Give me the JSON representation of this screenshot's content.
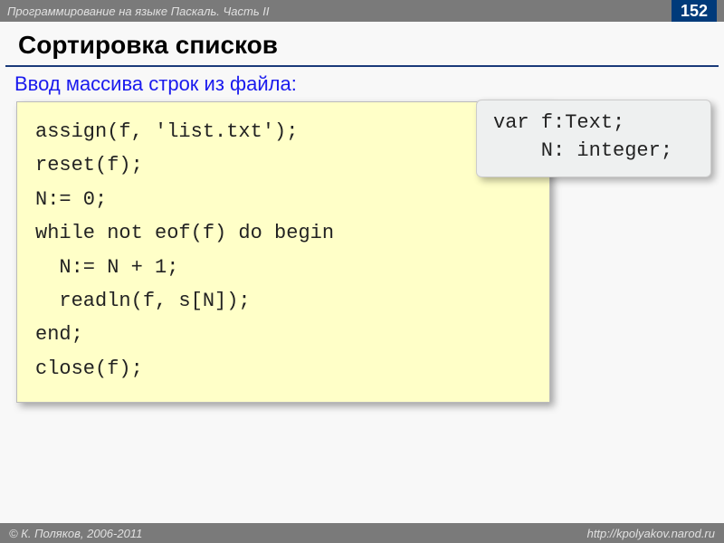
{
  "header": {
    "course_title": "Программирование на языке Паскаль. Часть II",
    "page_number": "152"
  },
  "title": "Сортировка списков",
  "subtitle": "Ввод массива строк из файла:",
  "code": {
    "lines": [
      "assign(f, 'list.txt');",
      "reset(f);",
      "N:= 0;",
      "while not eof(f) do begin",
      "  N:= N + 1;",
      "  readln(f, s[N]);",
      "end;",
      "close(f);"
    ]
  },
  "var_declaration": {
    "lines": [
      "var f:Text;",
      "    N: integer;"
    ]
  },
  "footer": {
    "copyright": "© К. Поляков, 2006-2011",
    "url": "http://kpolyakov.narod.ru"
  }
}
